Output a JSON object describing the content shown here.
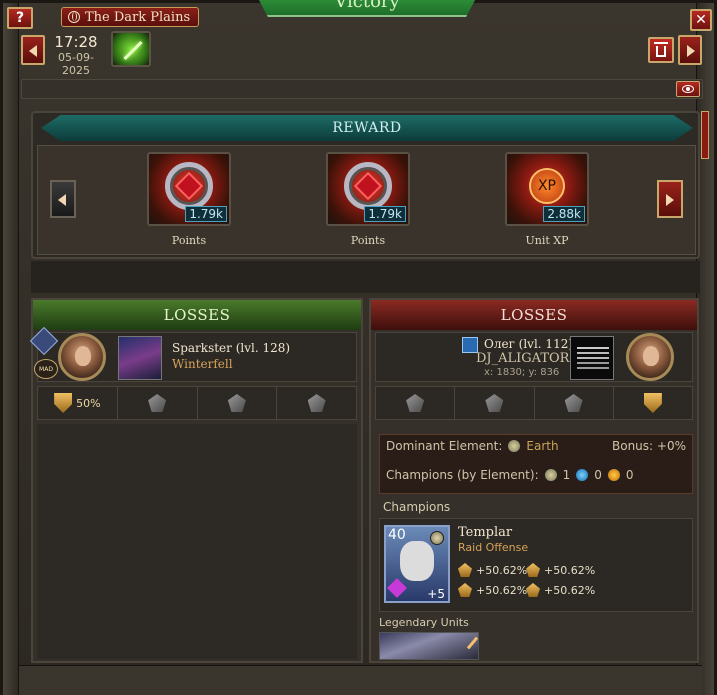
{
  "window": {
    "title": "Victory",
    "help_label": "?",
    "close_label": "✕",
    "location": "The Dark Plains"
  },
  "header": {
    "time": "17:28",
    "date": "05-09-2025"
  },
  "reward": {
    "title": "REWARD",
    "items": [
      {
        "label": "Points",
        "count": "1.79k",
        "icon": "ruby-medal-icon"
      },
      {
        "label": "Points",
        "count": "1.79k",
        "icon": "ruby-medal-icon"
      },
      {
        "label": "Unit XP",
        "count": "2.88k",
        "icon": "xp-icon",
        "badge": "XP"
      }
    ]
  },
  "left_side": {
    "header": "LOSSES",
    "player_name": "Sparkster   (lvl. 128)",
    "player_location": "Winterfell",
    "mad_badge": "MAD",
    "tabs": [
      {
        "icon": "shield-icon",
        "value": "50%"
      },
      {
        "icon": "infantry-icon",
        "value": ""
      },
      {
        "icon": "ranged-icon",
        "value": ""
      },
      {
        "icon": "siege-icon",
        "value": ""
      }
    ]
  },
  "right_side": {
    "header": "LOSSES",
    "player_name": "Олег (lvl. 112)",
    "alliance": "DJ_ALIGATOR",
    "coords": "x: 1830; y: 836",
    "tabs": [
      {
        "icon": "infantry-icon"
      },
      {
        "icon": "cavalry-icon"
      },
      {
        "icon": "ranged-icon"
      },
      {
        "icon": "shield-icon"
      }
    ],
    "dominant_element_label": "Dominant Element:",
    "dominant_element_value": "Earth",
    "bonus": "Bonus: +0%",
    "champions_by_element_label": "Champions (by Element):",
    "earth_count": "1",
    "water_count": "0",
    "fire_count": "0",
    "champions_label": "Champions",
    "champion": {
      "name": "Templar",
      "role": "Raid Offense",
      "level": "40",
      "plus": "+5",
      "stats": [
        "+50.62%",
        "+50.62%",
        "+50.62%",
        "+50.62%"
      ]
    },
    "legendary_units_label": "Legendary Units"
  },
  "colors": {
    "accent_red": "#8a1f18",
    "victory_green": "#2f8a3a",
    "reward_teal": "#1e6b66",
    "gold_text": "#d6a45a"
  }
}
